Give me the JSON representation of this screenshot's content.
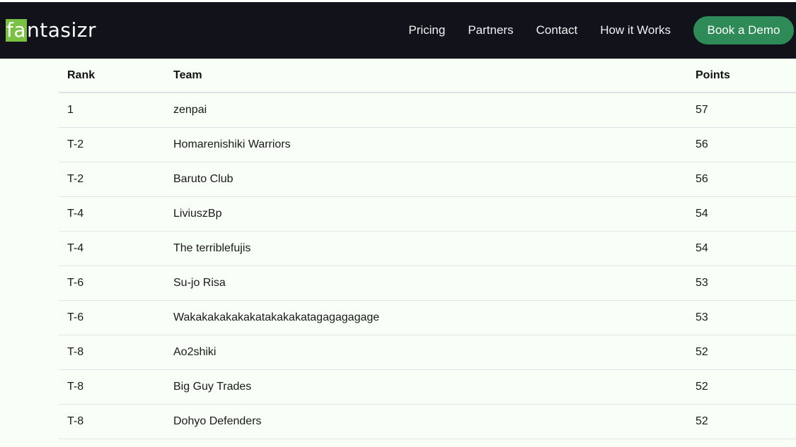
{
  "header": {
    "logo_highlight": "fa",
    "logo_rest": "ntasizr",
    "nav": [
      "Pricing",
      "Partners",
      "Contact",
      "How it Works"
    ],
    "cta_label": "Book a Demo"
  },
  "table": {
    "columns": [
      "Rank",
      "Team",
      "Points"
    ],
    "rows": [
      {
        "rank": "1",
        "team": "zenpai",
        "points": "57"
      },
      {
        "rank": "T-2",
        "team": "Homarenishiki Warriors",
        "points": "56"
      },
      {
        "rank": "T-2",
        "team": "Baruto Club",
        "points": "56"
      },
      {
        "rank": "T-4",
        "team": "LiviuszBp",
        "points": "54"
      },
      {
        "rank": "T-4",
        "team": "The terriblefujis",
        "points": "54"
      },
      {
        "rank": "T-6",
        "team": "Su-jo Risa",
        "points": "53"
      },
      {
        "rank": "T-6",
        "team": "Wakakakakakakatakakakatagagagagage",
        "points": "53"
      },
      {
        "rank": "T-8",
        "team": "Ao2shiki",
        "points": "52"
      },
      {
        "rank": "T-8",
        "team": "Big Guy Trades",
        "points": "52"
      },
      {
        "rank": "T-8",
        "team": "Dohyo Defenders",
        "points": "52"
      }
    ]
  },
  "colors": {
    "navbar": "#12121a",
    "logo_accent": "#7ac143",
    "cta": "#2e8b57",
    "page_bg": "#f8fff7"
  }
}
